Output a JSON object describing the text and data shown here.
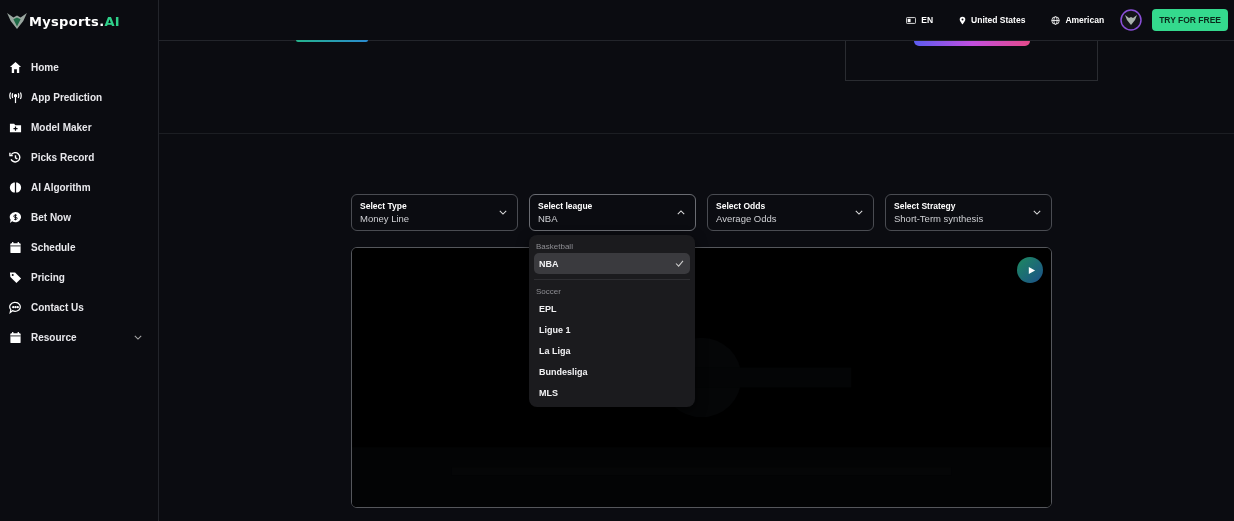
{
  "brand": {
    "name": "Mysports.",
    "suffix": "AI"
  },
  "sidebar": {
    "items": [
      {
        "label": "Home"
      },
      {
        "label": "App Prediction"
      },
      {
        "label": "Model Maker"
      },
      {
        "label": "Picks Record"
      },
      {
        "label": "AI Algorithm"
      },
      {
        "label": "Bet Now"
      },
      {
        "label": "Schedule"
      },
      {
        "label": "Pricing"
      },
      {
        "label": "Contact Us"
      },
      {
        "label": "Resource",
        "expandable": true
      }
    ]
  },
  "topbar": {
    "language": "EN",
    "region": "United States",
    "odds_format": "American",
    "cta": "TRY FOR FREE"
  },
  "selects": [
    {
      "label": "Select Type",
      "value": "Money Line",
      "open": false
    },
    {
      "label": "Select league",
      "value": "NBA",
      "open": true
    },
    {
      "label": "Select Odds",
      "value": "Average Odds",
      "open": false
    },
    {
      "label": "Select Strategy",
      "value": "Short-Term synthesis",
      "open": false
    }
  ],
  "dropdown": {
    "groups": [
      {
        "heading": "Basketball",
        "options": [
          {
            "label": "NBA",
            "selected": true
          }
        ]
      },
      {
        "heading": "Soccer",
        "options": [
          {
            "label": "EPL",
            "selected": false
          },
          {
            "label": "Ligue 1",
            "selected": false
          },
          {
            "label": "La Liga",
            "selected": false
          },
          {
            "label": "Bundesliga",
            "selected": false
          },
          {
            "label": "MLS",
            "selected": false
          }
        ]
      }
    ]
  }
}
